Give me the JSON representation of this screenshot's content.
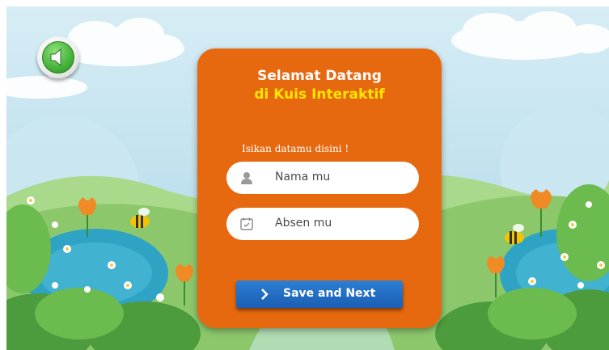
{
  "card": {
    "title_line1": "Selamat Datang",
    "title_line2": "di Kuis Interaktif",
    "hint": "Isikan datamu disini !",
    "name_placeholder": "Nama mu",
    "absen_placeholder": "Absen mu",
    "save_label": "Save and Next"
  },
  "icons": {
    "back": "back-speaker-icon",
    "user": "user-icon",
    "calendar": "calendar-check-icon",
    "chevron": "chevron-right-icon"
  },
  "colors": {
    "card_bg": "#e7690f",
    "title_white": "#ffffff",
    "title_yellow": "#ffe500",
    "button_blue": "#2474c8",
    "back_green": "#44b33a"
  }
}
